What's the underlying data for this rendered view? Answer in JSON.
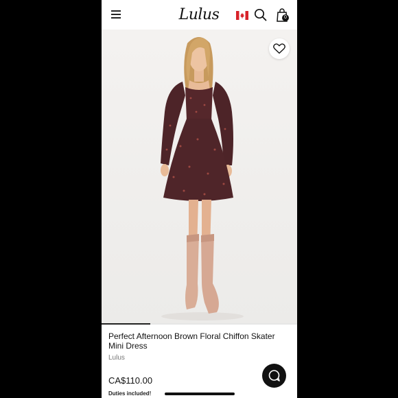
{
  "header": {
    "logo_text": "Lulus",
    "menu_icon": "hamburger-menu-icon",
    "flag_icon": "canada-flag-icon",
    "search_icon": "search-icon",
    "bag_icon": "shopping-bag-icon",
    "bag_count": "0"
  },
  "gallery": {
    "wishlist_icon": "heart-icon",
    "progress_fraction": 0.25
  },
  "product": {
    "title": "Perfect Afternoon Brown Floral Chiffon Skater Mini Dress",
    "brand": "Lulus",
    "price": "CA$110.00",
    "duties_note": "Duties included!"
  },
  "chat": {
    "icon": "chat-bubble-icon"
  },
  "colors": {
    "accent": "#111111",
    "background": "#ffffff",
    "dress": "#4a2226",
    "boots": "#d9ad97"
  }
}
